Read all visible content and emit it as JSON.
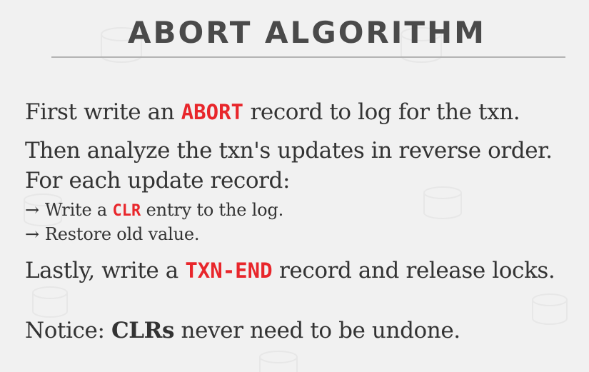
{
  "slide": {
    "title": "ABORT ALGORITHM",
    "accent_color": "#e8262b",
    "lines": [
      {
        "before": "First write an ",
        "code": "ABORT",
        "after": " record to log for the txn."
      },
      {
        "text": "Then analyze the txn's updates in reverse order."
      },
      {
        "text": "For each update record:"
      },
      {
        "arrow": "→",
        "before": "Write a ",
        "code": "CLR",
        "after": " entry to the log."
      },
      {
        "arrow": "→",
        "text": "Restore old value."
      },
      {
        "before": "Lastly, write a ",
        "code": "TXN-END",
        "after": " record and release locks."
      },
      {
        "before": "Notice: ",
        "bold": "CLRs",
        "after": " never need to be undone."
      }
    ]
  }
}
